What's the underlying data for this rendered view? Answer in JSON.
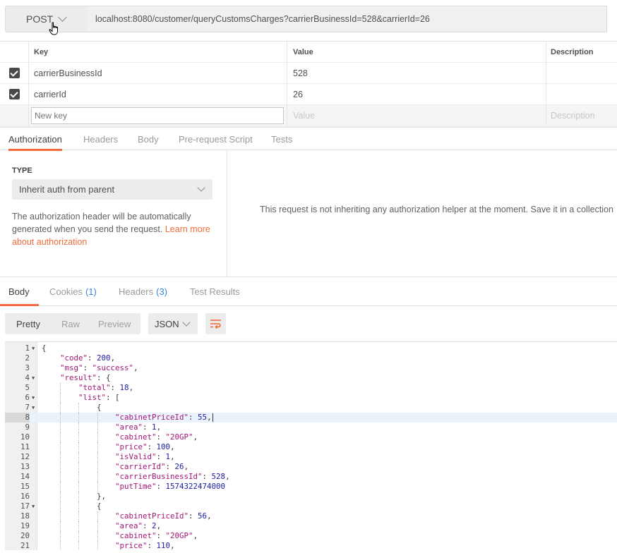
{
  "request": {
    "method": "POST",
    "url": "localhost:8080/customer/queryCustomsCharges?carrierBusinessId=528&carrierId=26"
  },
  "params": {
    "headers": {
      "key": "Key",
      "value": "Value",
      "description": "Description"
    },
    "rows": [
      {
        "key": "carrierBusinessId",
        "value": "528",
        "checked": true
      },
      {
        "key": "carrierId",
        "value": "26",
        "checked": true
      }
    ],
    "new_row": {
      "key_placeholder": "New key",
      "value_placeholder": "Value",
      "description_placeholder": "Description"
    }
  },
  "request_tabs": {
    "authorization": "Authorization",
    "headers": "Headers",
    "body": "Body",
    "prerequest": "Pre-request Script",
    "tests": "Tests"
  },
  "auth": {
    "type_label": "TYPE",
    "type_value": "Inherit auth from parent",
    "desc_text": "The authorization header will be automatically generated when you send the request.",
    "learn_link": "Learn more about authorization",
    "message": "This request is not inheriting any authorization helper at the moment. Save it in a collection"
  },
  "response_tabs": {
    "body": "Body",
    "cookies": "Cookies",
    "cookies_count": "(1)",
    "headers": "Headers",
    "headers_count": "(3)",
    "test_results": "Test Results"
  },
  "format": {
    "pretty": "Pretty",
    "raw": "Raw",
    "preview": "Preview",
    "language": "JSON"
  },
  "code_lines": [
    {
      "n": "1",
      "fold": true,
      "text": "{"
    },
    {
      "n": "2",
      "text": "    \"code\": 200,"
    },
    {
      "n": "3",
      "text": "    \"msg\": \"success\","
    },
    {
      "n": "4",
      "fold": true,
      "text": "    \"result\": {"
    },
    {
      "n": "5",
      "text": "        \"total\": 18,"
    },
    {
      "n": "6",
      "fold": true,
      "text": "        \"list\": ["
    },
    {
      "n": "7",
      "fold": true,
      "text": "            {"
    },
    {
      "n": "8",
      "highlight": true,
      "text": "                \"cabinetPriceId\": 55,"
    },
    {
      "n": "9",
      "text": "                \"area\": 1,"
    },
    {
      "n": "10",
      "text": "                \"cabinet\": \"20GP\","
    },
    {
      "n": "11",
      "text": "                \"price\": 100,"
    },
    {
      "n": "12",
      "text": "                \"isValid\": 1,"
    },
    {
      "n": "13",
      "text": "                \"carrierId\": 26,"
    },
    {
      "n": "14",
      "text": "                \"carrierBusinessId\": 528,"
    },
    {
      "n": "15",
      "text": "                \"putTime\": 1574322474000"
    },
    {
      "n": "16",
      "text": "            },"
    },
    {
      "n": "17",
      "fold": true,
      "text": "            {"
    },
    {
      "n": "18",
      "text": "                \"cabinetPriceId\": 56,"
    },
    {
      "n": "19",
      "text": "                \"area\": 2,"
    },
    {
      "n": "20",
      "text": "                \"cabinet\": \"20GP\","
    },
    {
      "n": "21",
      "text": "                \"price\": 110,"
    }
  ],
  "colors": {
    "accent": "#f26b3a",
    "count": "#3a84d6",
    "json_key": "#a31576",
    "json_number": "#1a1aa6"
  }
}
